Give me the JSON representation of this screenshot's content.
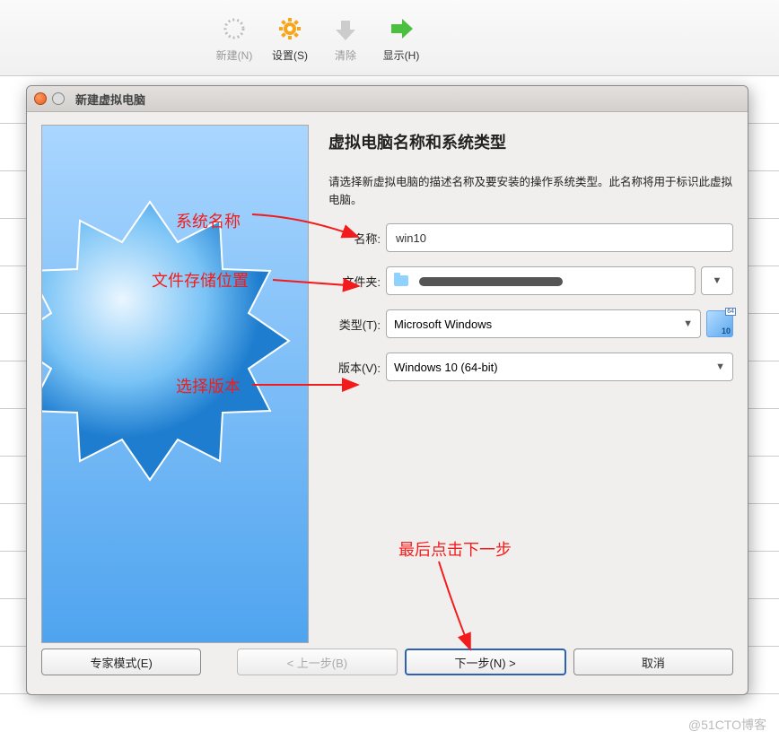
{
  "toolbar": {
    "new": "新建(N)",
    "settings": "设置(S)",
    "clear": "清除",
    "show": "显示(H)"
  },
  "dialog": {
    "title": "新建虚拟电脑",
    "heading": "虚拟电脑名称和系统类型",
    "desc": "请选择新虚拟电脑的描述名称及要安装的操作系统类型。此名称将用于标识此虚拟电脑。",
    "labels": {
      "name": "名称:",
      "folder": "文件夹:",
      "type": "类型(T):",
      "version": "版本(V):"
    },
    "values": {
      "name": "win10",
      "type": "Microsoft Windows",
      "version": "Windows 10 (64-bit)"
    },
    "buttons": {
      "expert": "专家模式(E)",
      "back": "< 上一步(B)",
      "next": "下一步(N) >",
      "cancel": "取消"
    }
  },
  "annotations": {
    "name": "系统名称",
    "folder": "文件存储位置",
    "version": "选择版本",
    "next": "最后点击下一步"
  },
  "watermark": "@51CTO博客"
}
